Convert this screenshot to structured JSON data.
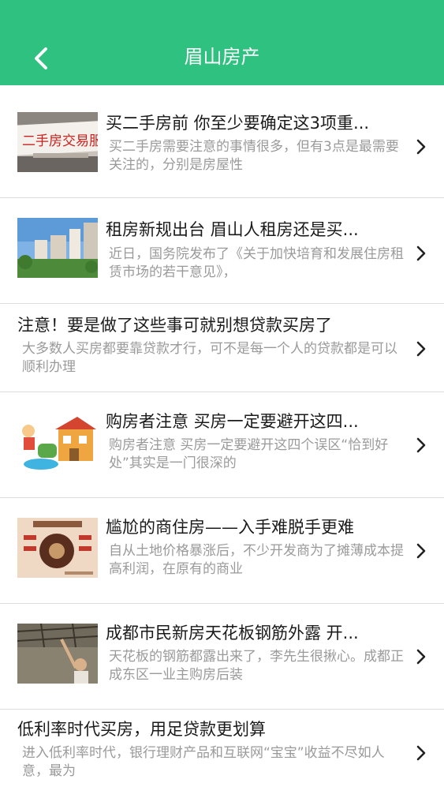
{
  "header": {
    "title": "眉山房产"
  },
  "articles": [
    {
      "title": "买二手房前 你至少要确定这3项重...",
      "desc": "买二手房需要注意的事情很多，但有3点是最需要关注的，分别是房屋性"
    },
    {
      "title": "租房新规出台 眉山人租房还是买...",
      "desc": "近日，国务院发布了《关于加快培育和发展住房租赁市场的若干意见》，"
    },
    {
      "title": "注意！要是做了这些事可就别想贷款买房了",
      "desc": "大多数人买房都要靠贷款才行，可不是每一个人的贷款都是可以顺利办理"
    },
    {
      "title": "购房者注意 买房一定要避开这四...",
      "desc": "购房者注意 买房一定要避开这四个误区“恰到好处”其实是一门很深的"
    },
    {
      "title": "尴尬的商住房——入手难脱手更难",
      "desc": "自从土地价格暴涨后，不少开发商为了摊薄成本提高利润，在原有的商业"
    },
    {
      "title": "成都市民新房天花板钢筋外露 开...",
      "desc": "天花板的钢筋都露出来了，李先生很揪心。成都正成东区一业主购房后装"
    },
    {
      "title": "低利率时代买房，用足贷款更划算",
      "desc": "进入低利率时代，银行理财产品和互联网“宝宝”收益不尽如人意，最为"
    }
  ],
  "thumb_texts": {
    "secondhand_sign": "二手房交易服务"
  },
  "colors": {
    "header": "#2fc17f"
  }
}
